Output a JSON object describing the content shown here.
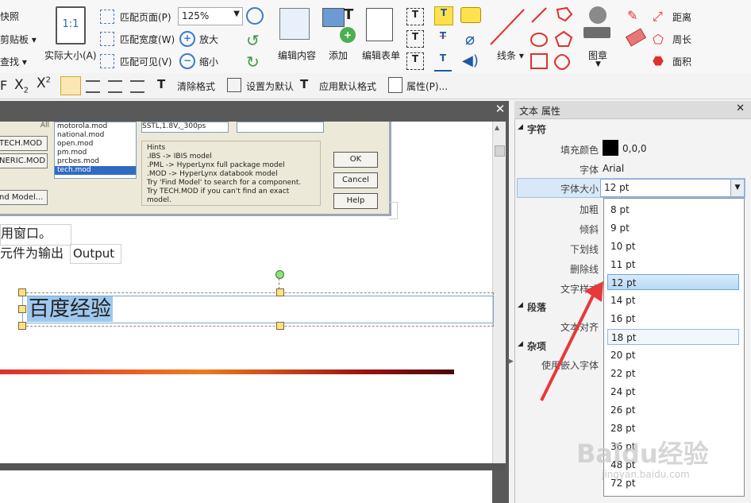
{
  "ribbon": {
    "left_items": [
      "快照",
      "剪贴板",
      "查找"
    ],
    "actual_size": "实际大小(A)",
    "fit_page": "匹配页面(P)",
    "fit_width": "匹配宽度(W)",
    "fit_visible": "匹配可见(V)",
    "zoom_value": "125%",
    "zoom_in": "放大",
    "zoom_out": "缩小",
    "edit_content": "编辑内容",
    "add": "添加",
    "edit_form": "编辑表单",
    "line": "线条",
    "stamp": "图章",
    "distance": "距离",
    "perimeter": "周长",
    "area": "面积",
    "one_to_one": "1:1"
  },
  "format_bar": {
    "clear_format": "清除格式",
    "set_default": "设置为默认",
    "apply_default": "应用默认格式",
    "properties": "属性(P)..."
  },
  "document": {
    "list_items": [
      "motorola.mod",
      "national.mod",
      "open.mod",
      "pm.mod",
      "prcbes.mod",
      "tech.mod"
    ],
    "left_buttons": [
      "TECH.MOD",
      "NERIC.MOD",
      "nd Model..."
    ],
    "all_label": "All",
    "combo_value": "SSTL,1.8V,_300ps",
    "hints_title": "Hints",
    "hints": [
      ".IBS   -> IBIS model",
      ".PML  -> HyperLynx full package model",
      ".MOD -> HyperLynx databook model",
      "Try 'Find Model' to search for a component.",
      "Try TECH.MOD if you can't find an exact model."
    ],
    "dialog_buttons": [
      "OK",
      "Cancel",
      "Help"
    ],
    "text_line1": "用窗口。",
    "text_line2": "元件为输出",
    "output_word": "Output",
    "selected_text": "百度经验"
  },
  "panel": {
    "title": "文本 属性",
    "section_char": "字符",
    "fill_color_label": "填充颜色",
    "fill_color_value": "0,0,0",
    "fill_color_hex": "#000000",
    "font_label": "字体",
    "font_value": "Arial",
    "size_label": "字体大小",
    "size_value": "12 pt",
    "bold_label": "加粗",
    "italic_label": "倾斜",
    "underline_label": "下划线",
    "strike_label": "删除线",
    "text_style_label": "文字样式",
    "section_para": "段落",
    "align_label": "文本对齐",
    "section_misc": "杂项",
    "embed_font_label": "使用嵌入字体"
  },
  "dropdown": {
    "options": [
      "8 pt",
      "9 pt",
      "10 pt",
      "11 pt",
      "12 pt",
      "14 pt",
      "16 pt",
      "18 pt",
      "20 pt",
      "22 pt",
      "24 pt",
      "26 pt",
      "28 pt",
      "36 pt",
      "48 pt",
      "72 pt"
    ],
    "selected": "12 pt",
    "hovered": "18 pt"
  },
  "watermark": {
    "brand": "Baidu经验",
    "url": "jingyan.baidu.com"
  },
  "colors": {
    "accent_red": "#e0302c",
    "selection_blue": "#9fc8ee",
    "arrow_red": "#e8383a"
  }
}
